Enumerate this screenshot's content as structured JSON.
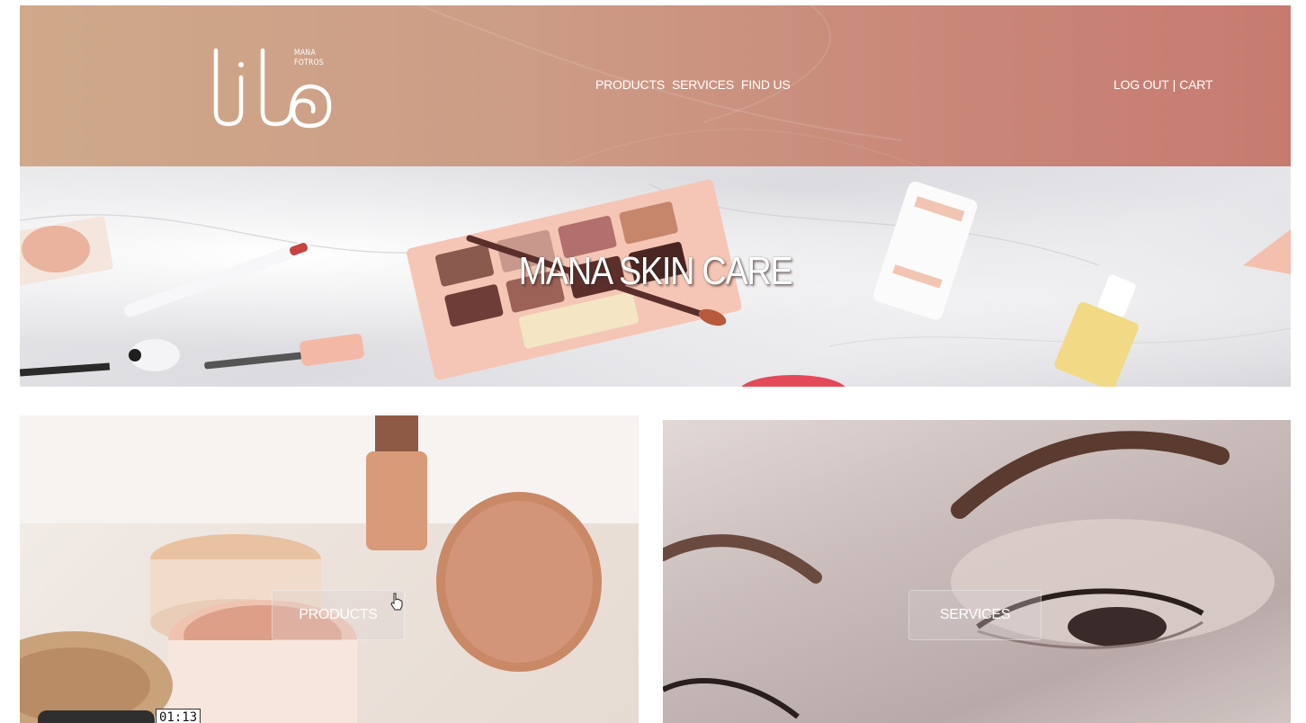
{
  "header": {
    "logo_text": "lib",
    "logo_sub_line1": "MANA",
    "logo_sub_line2": "FOTROS",
    "nav": [
      "PRODUCTS",
      "SERVICES",
      "FIND US"
    ],
    "auth": {
      "logout": "LOG OUT",
      "separator": "|",
      "cart": "CART"
    },
    "gradient_colors": [
      "#cfa98a",
      "#c77b70"
    ]
  },
  "hero": {
    "title": "MANA SKIN CARE"
  },
  "cards": {
    "products": {
      "button_label": "PRODUCTS"
    },
    "services": {
      "button_label": "SERVICES"
    }
  },
  "video": {
    "time": "01:13"
  },
  "icons": [
    "logo",
    "pointer-hand-icon"
  ]
}
